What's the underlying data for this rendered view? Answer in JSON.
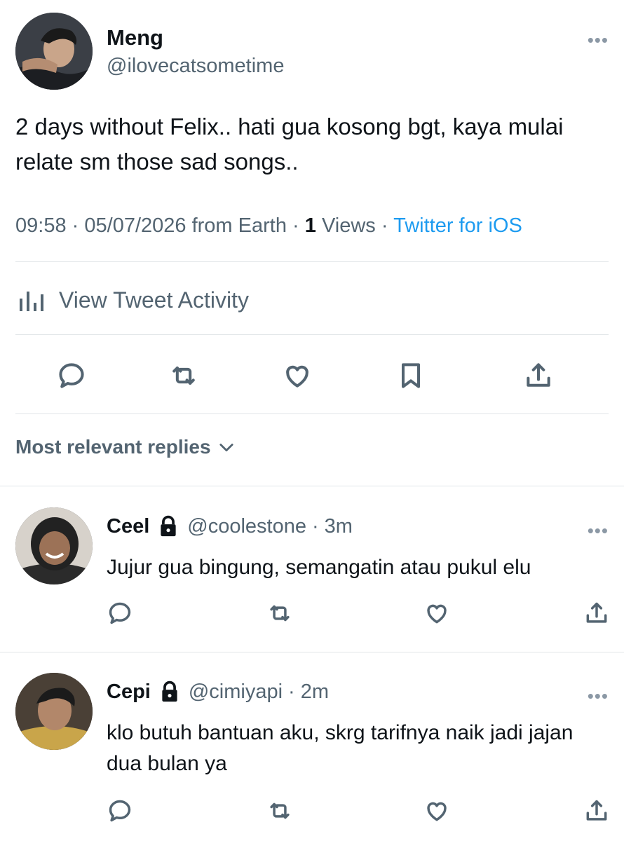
{
  "tweet": {
    "author_name": "Meng",
    "author_handle": "@ilovecatsometime",
    "text": "2 days without Felix.. hati gua kosong bgt, kaya mulai relate sm those sad songs..",
    "time": "09:58",
    "date": "05/07/2026",
    "location_prefix": "from Earth",
    "views_count": "1",
    "views_label": "Views",
    "source": "Twitter for iOS",
    "sep": "·",
    "more_icon": "more-horizontal-icon"
  },
  "activity": {
    "label": "View Tweet Activity",
    "icon": "bar-chart-icon"
  },
  "actions": [
    "reply-icon",
    "retweet-icon",
    "like-icon",
    "bookmark-icon",
    "share-icon"
  ],
  "replies_filter": {
    "label": "Most relevant replies",
    "icon": "chevron-down-icon"
  },
  "replies": [
    {
      "name": "Ceel",
      "handle": "@coolestone",
      "time": "3m",
      "text": "Jujur gua bingung, semangatin atau pukul elu",
      "protected": true
    },
    {
      "name": "Cepi",
      "handle": "@cimiyapi",
      "time": "2m",
      "text": "klo butuh bantuan aku, skrg tarifnya naik jadi jajan dua bulan ya",
      "protected": true
    }
  ],
  "colors": {
    "text": "#0f1419",
    "muted": "#536471",
    "link": "#1d9bf0",
    "divider": "#e1e5e8"
  }
}
